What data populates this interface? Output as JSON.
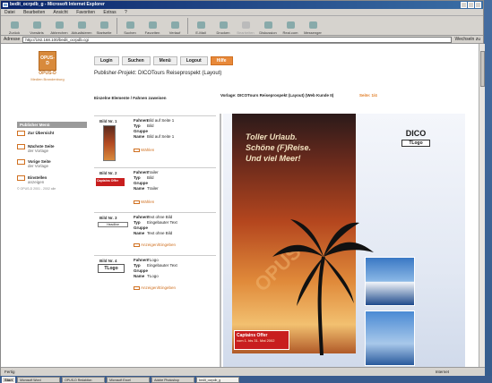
{
  "window": {
    "title": "bedit_ocrpdb_g - Microsoft Internet Explorer",
    "menu": [
      "Datei",
      "Bearbeiten",
      "Ansicht",
      "Favoriten",
      "Extras",
      "?"
    ]
  },
  "toolbar": {
    "buttons": [
      {
        "label": "Zurück",
        "disabled": false
      },
      {
        "label": "Vorwärts",
        "disabled": false
      },
      {
        "label": "Abbrechen",
        "disabled": false
      },
      {
        "label": "Aktualisieren",
        "disabled": false
      },
      {
        "label": "Startseite",
        "disabled": false
      },
      {
        "label": "Suchen",
        "disabled": false
      },
      {
        "label": "Favoriten",
        "disabled": false
      },
      {
        "label": "Verlauf",
        "disabled": false
      },
      {
        "label": "E-Mail",
        "disabled": false
      },
      {
        "label": "Drucken",
        "disabled": false
      },
      {
        "label": "Bearbeiten",
        "disabled": true
      },
      {
        "label": "Diskussion",
        "disabled": false
      },
      {
        "label": "Real.com",
        "disabled": false
      },
      {
        "label": "Messenger",
        "disabled": false
      }
    ],
    "address_label": "Adresse",
    "address": "http://192.168.100/bedit_ocrpdb.cgi",
    "links_label": "Wechseln zu"
  },
  "logo": {
    "box": "OPUS-D",
    "title": "OPUS-D",
    "subtitle": "Medien Brandenburg"
  },
  "nav": [
    "Login",
    "Suchen",
    "Menü",
    "Logout",
    "Hilfe"
  ],
  "project_title": "Publisher-Projekt: DICOTours Reiseprospekt (Layout)",
  "subheader_left": "Einzelne Elemente / Fahnen zuweisen",
  "subheader_mid": "Vorlage: DICOTours Reiseprospekt (Layout) (Web Kunde II)",
  "subheader_right": "Seite: 1/4",
  "sidebar": {
    "heading": "Publisher Menü",
    "items": [
      {
        "title": "Zur Übersicht",
        "detail": ""
      },
      {
        "title": "Nächste Seite",
        "detail": "der Vorlage"
      },
      {
        "title": "Vorige Seite",
        "detail": "der Vorlage"
      },
      {
        "title": "Einstellen",
        "detail": "anzeigen"
      }
    ],
    "copyright": "© OPUS-D 2001 - 2002 alle"
  },
  "slots": [
    {
      "header": "Bild Nr. 1",
      "fields": [
        [
          "Fahnen",
          "Bild auf Seite 1"
        ],
        [
          "Typ",
          "Bild"
        ],
        [
          "Gruppe",
          ""
        ],
        [
          "Name",
          "Bild auf Seite 1"
        ]
      ],
      "link": "Wählen"
    },
    {
      "header": "Bild Nr. 2",
      "fields": [
        [
          "Fahnen",
          "Trailer"
        ],
        [
          "Typ",
          "Bild"
        ],
        [
          "Gruppe",
          ""
        ],
        [
          "Name",
          "Trailer"
        ]
      ],
      "link": "Wählen",
      "badge": "Captains Offer"
    },
    {
      "header": "Bild Nr. 3",
      "fields": [
        [
          "Fahnen",
          "Text ohne Bild"
        ],
        [
          "Typ",
          "Eingebauter Text"
        ],
        [
          "Gruppe",
          ""
        ],
        [
          "Name",
          "Text ohne Bild"
        ]
      ],
      "link": "Anzeigen/Eingeben",
      "badge": "Headline"
    },
    {
      "header": "Bild Nr. 4",
      "fields": [
        [
          "Fahnen",
          "TLogo"
        ],
        [
          "Typ",
          "Eingebauter Text"
        ],
        [
          "Gruppe",
          ""
        ],
        [
          "Name",
          "TLogo"
        ]
      ],
      "link": "Anzeigen/Eingeben",
      "badge": "TLogo"
    }
  ],
  "poster": {
    "headline": [
      "Toller Urlaub.",
      "Schöne (F)Reise.",
      "Und viel Meer!"
    ],
    "brand": "DICO",
    "brand_sub": "TLogo",
    "watermark": "OPUS",
    "cta_title": "Captains Offer",
    "cta_detail": "vom 1. bis 31. Mai 2002"
  },
  "status": {
    "left": "Fertig",
    "zone": "Internet"
  },
  "taskbar": {
    "start": "Start",
    "tasks": [
      "Start",
      "Microsoft Word",
      "OPUS-D Redaktion",
      "Microsoft Excel",
      "Adobe Photoshop",
      "bedit_ocrpdb_g"
    ]
  }
}
